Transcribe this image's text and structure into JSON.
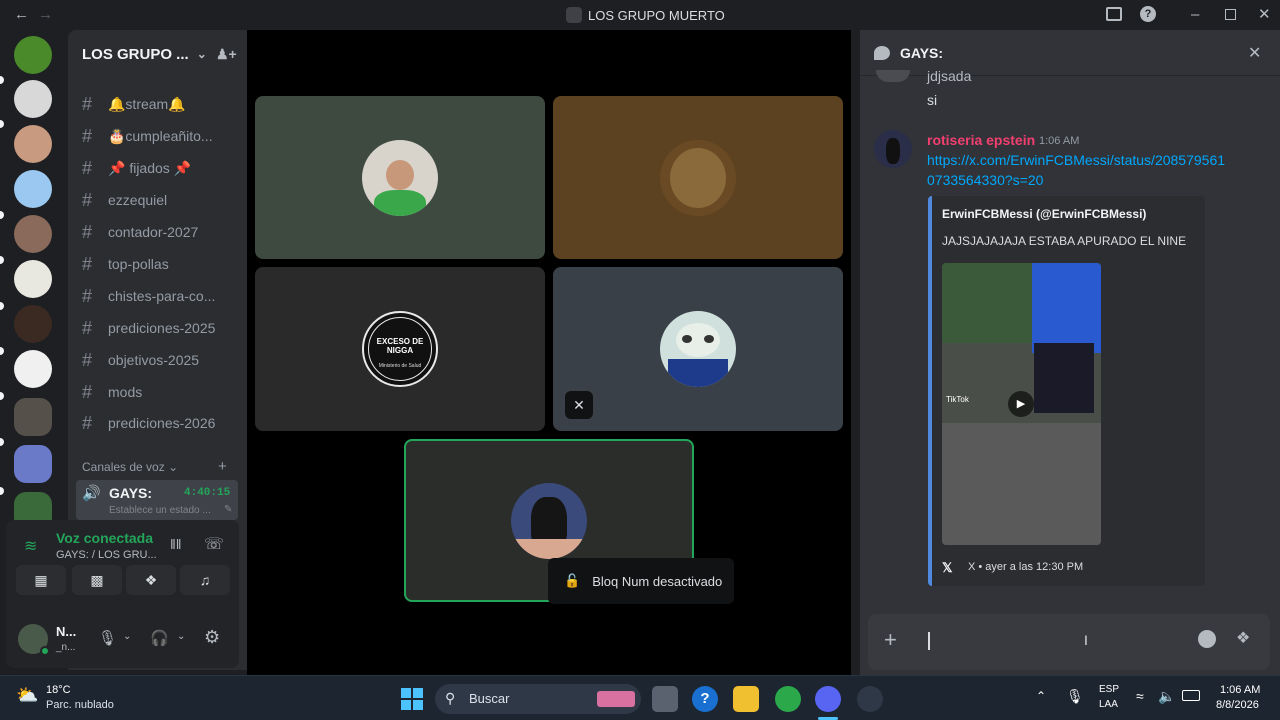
{
  "window": {
    "title": "LOS GRUPO MUERTO"
  },
  "server": {
    "name": "LOS GRUPO ..."
  },
  "channels": [
    {
      "label": "🔔stream🔔"
    },
    {
      "label": "🎂cumpleañito..."
    },
    {
      "label": "📌 fijados 📌"
    },
    {
      "label": "ezzequiel"
    },
    {
      "label": "contador-2027"
    },
    {
      "label": "top-pollas"
    },
    {
      "label": "chistes-para-co..."
    },
    {
      "label": "prediciones-2025"
    },
    {
      "label": "objetivos-2025"
    },
    {
      "label": "mods"
    },
    {
      "label": "prediciones-2026"
    }
  ],
  "voice_category": {
    "label": "Canales de voz"
  },
  "voice_channel": {
    "name": "GAYS:",
    "timer": "4:40:15",
    "status_placeholder": "Establece un estado ..."
  },
  "voice_panel": {
    "status": "Voz conectada",
    "location": "GAYS: / LOS GRU..."
  },
  "user": {
    "name": "N...",
    "tag": "_n..."
  },
  "stage": {
    "tile_colors": [
      "#3e4a40",
      "#5c4220",
      "#2a2a2a",
      "#3a4048",
      "#2b2d2a"
    ],
    "tile5_avatar_label": "EXCESO DE NIGGA",
    "tile5_avatar_sublabel": "Ministerio de Salud"
  },
  "tooltip": {
    "text": "Bloq Num desactivado"
  },
  "chat": {
    "channel": "GAYS:",
    "prev_lines": [
      "jdjsada",
      "si"
    ],
    "message": {
      "author": "rotiseria epstein",
      "author_color": "#f23f70",
      "time": "1:06 AM",
      "link_line1": "https://x.com/ErwinFCBMessi/status/208579561",
      "link_line2": "0733564330?s=20"
    },
    "embed": {
      "author": "ErwinFCBMessi (@ErwinFCBMessi)",
      "description": "JAJSJAJAJAJA ESTABA APURADO EL NINE",
      "media_watermark": "TikTok",
      "footer": "X • ayer a las 12:30 PM"
    }
  },
  "taskbar": {
    "weather_temp": "18°C",
    "weather_desc": "Parc. nublado",
    "search_placeholder": "Buscar",
    "lang_line1": "ESP",
    "lang_line2": "LAA",
    "clock_time": "1:06 AM",
    "clock_date": "8/8/2026"
  }
}
